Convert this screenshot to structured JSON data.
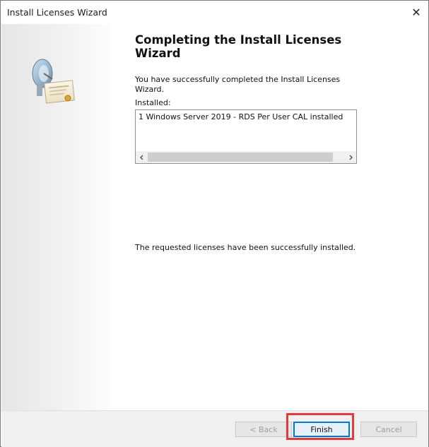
{
  "window": {
    "title": "Install Licenses Wizard",
    "close_glyph": "✕"
  },
  "main": {
    "heading": "Completing the Install Licenses Wizard",
    "success_message": "You have successfully completed the Install Licenses Wizard.",
    "installed_label": "Installed:",
    "installed_items": [
      "1 Windows Server 2019 - RDS Per User CAL installed"
    ],
    "result_message": "The requested licenses have been successfully installed."
  },
  "footer": {
    "back_label": "< Back",
    "finish_label": "Finish",
    "cancel_label": "Cancel"
  },
  "icons": {
    "wizard_graphic": "satellite-dish-certificate-icon",
    "scroll_left": "chevron-left-icon",
    "scroll_right": "chevron-right-icon"
  },
  "colors": {
    "highlight": "#e33b3b",
    "focus": "#0078d7"
  }
}
